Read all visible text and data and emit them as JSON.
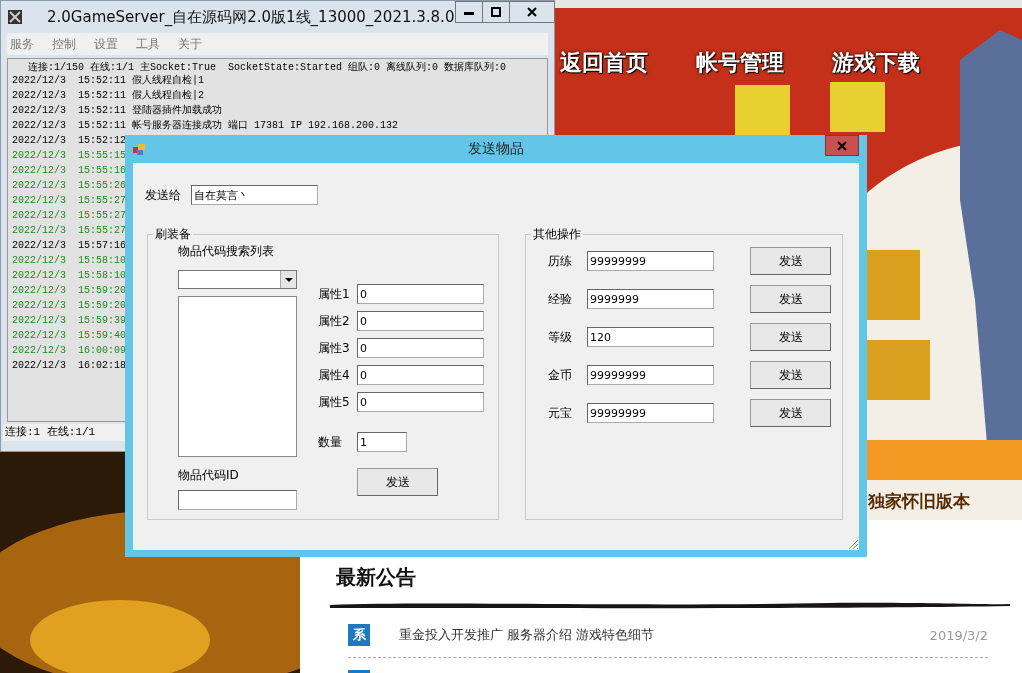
{
  "website": {
    "nav": [
      "返回首页",
      "帐号管理",
      "游戏下载"
    ],
    "banner_caption": "独家怀旧版本",
    "news_title": "最新公告",
    "news": [
      {
        "badge": "系",
        "title": "重金投入开发推广 服务器介绍 游戏特色细节",
        "date": "2019/3/2"
      }
    ]
  },
  "server_window": {
    "title": "2.0GameServer_自在源码网2.0版1线_13000_2021.3.8.0",
    "menu": [
      "服务",
      "控制",
      "设置",
      "工具",
      "关于"
    ],
    "stats_line": "连接:1/150 在线:1/1 主Socket:True  SocketState:Started 组队:0 离线队列:0 数据库队列:0",
    "log": [
      {
        "text": "2022/12/3  15:52:11 假人线程自检|1",
        "kind": "normal"
      },
      {
        "text": "2022/12/3  15:52:11 假人线程自检|2",
        "kind": "normal"
      },
      {
        "text": "2022/12/3  15:52:11 登陆器插件加载成功",
        "kind": "normal"
      },
      {
        "text": "2022/12/3  15:52:11 帐号服务器连接成功 端口 17381 IP 192.168.200.132",
        "kind": "normal"
      },
      {
        "text": "2022/12/3  15:52:12",
        "kind": "normal"
      },
      {
        "text": "2022/12/3  15:55:15",
        "kind": "player"
      },
      {
        "text": "2022/12/3  15:55:16",
        "kind": "player"
      },
      {
        "text": "2022/12/3  15:55:26",
        "kind": "player"
      },
      {
        "text": "2022/12/3  15:55:27",
        "kind": "player"
      },
      {
        "text": "2022/12/3  15:55:27",
        "kind": "player"
      },
      {
        "text": "2022/12/3  15:55:27",
        "kind": "player"
      },
      {
        "text": "2022/12/3  15:57:16",
        "kind": "normal"
      },
      {
        "text": "2022/12/3  15:58:10",
        "kind": "player"
      },
      {
        "text": "2022/12/3  15:58:10",
        "kind": "player"
      },
      {
        "text": "2022/12/3  15:59:20",
        "kind": "player"
      },
      {
        "text": "2022/12/3  15:59:20",
        "kind": "player"
      },
      {
        "text": "2022/12/3  15:59:39",
        "kind": "player"
      },
      {
        "text": "2022/12/3  15:59:40",
        "kind": "player"
      },
      {
        "text": "2022/12/3  16:00:09",
        "kind": "player"
      },
      {
        "text": "2022/12/3  16:02:18",
        "kind": "normal"
      }
    ],
    "status_bar": "连接:1 在线:1/1"
  },
  "dialog": {
    "title": "发送物品",
    "recipient_label": "发送给",
    "recipient": "自在莫言丶",
    "equipment_group": {
      "title": "刷装备",
      "search_label": "物品代码搜索列表",
      "id_label": "物品代码ID",
      "attributes": [
        {
          "label": "属性1",
          "value": "0"
        },
        {
          "label": "属性2",
          "value": "0"
        },
        {
          "label": "属性3",
          "value": "0"
        },
        {
          "label": "属性4",
          "value": "0"
        },
        {
          "label": "属性5",
          "value": "0"
        }
      ],
      "quantity_label": "数量",
      "quantity": "1",
      "send_button": "发送"
    },
    "other_group": {
      "title": "其他操作",
      "rows": [
        {
          "label": "历练",
          "value": "99999999",
          "button": "发送"
        },
        {
          "label": "经验",
          "value": "9999999",
          "button": "发送"
        },
        {
          "label": "等级",
          "value": "120",
          "button": "发送"
        },
        {
          "label": "金币",
          "value": "99999999",
          "button": "发送"
        },
        {
          "label": "元宝",
          "value": "99999999",
          "button": "发送"
        }
      ]
    }
  }
}
